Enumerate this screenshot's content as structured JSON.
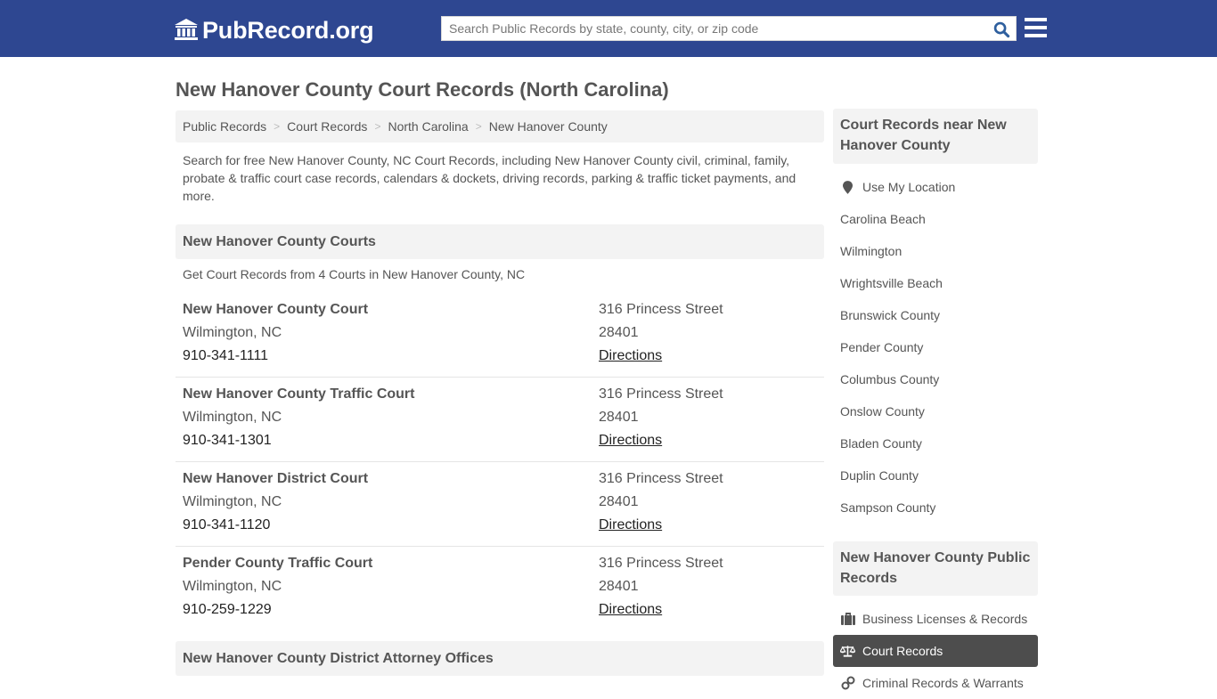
{
  "header": {
    "logo_text": "PubRecord.org",
    "logo_icon": "bank-building-icon",
    "search_placeholder": "Search Public Records by state, county, city, or zip code",
    "search_value": "",
    "search_icon": "search-icon",
    "menu_icon": "hamburger-menu-icon"
  },
  "colors": {
    "header_bg": "#2e4791",
    "search_icon": "#2e5f9e",
    "panel_bg": "#f3f3f3",
    "active_item_bg": "#4d4d4d"
  },
  "page": {
    "title": "New Hanover County Court Records (North Carolina)",
    "breadcrumb": [
      "Public Records",
      "Court Records",
      "North Carolina",
      "New Hanover County"
    ],
    "breadcrumb_separator": ">",
    "intro": "Search for free New Hanover County, NC Court Records, including New Hanover County civil, criminal, family, probate & traffic court case records, calendars & dockets, driving records, parking & traffic ticket payments, and more."
  },
  "courts_section": {
    "heading": "New Hanover County Courts",
    "subheading": "Get Court Records from 4 Courts in New Hanover County, NC",
    "courts": [
      {
        "name": "New Hanover County Court",
        "city": "Wilmington, NC",
        "phone": "910-341-1111",
        "street": "316 Princess Street",
        "zip": "28401",
        "directions": "Directions"
      },
      {
        "name": "New Hanover County Traffic Court",
        "city": "Wilmington, NC",
        "phone": "910-341-1301",
        "street": "316 Princess Street",
        "zip": "28401",
        "directions": "Directions"
      },
      {
        "name": "New Hanover District Court",
        "city": "Wilmington, NC",
        "phone": "910-341-1120",
        "street": "316 Princess Street",
        "zip": "28401",
        "directions": "Directions"
      },
      {
        "name": "Pender County Traffic Court",
        "city": "Wilmington, NC",
        "phone": "910-259-1229",
        "street": "316 Princess Street",
        "zip": "28401",
        "directions": "Directions"
      }
    ]
  },
  "da_section": {
    "heading": "New Hanover County District Attorney Offices"
  },
  "sidebar": {
    "nearby": {
      "heading": "Court Records near New Hanover County",
      "use_location": "Use My Location",
      "items": [
        "Carolina Beach",
        "Wilmington",
        "Wrightsville Beach",
        "Brunswick County",
        "Pender County",
        "Columbus County",
        "Onslow County",
        "Bladen County",
        "Duplin County",
        "Sampson County"
      ]
    },
    "public_records": {
      "heading": "New Hanover County Public Records",
      "items": [
        {
          "label": "Business Licenses & Records",
          "icon": "briefcase-icon",
          "active": false
        },
        {
          "label": "Court Records",
          "icon": "scales-icon",
          "active": true
        },
        {
          "label": "Criminal Records & Warrants",
          "icon": "handcuffs-icon",
          "active": false
        }
      ]
    }
  }
}
